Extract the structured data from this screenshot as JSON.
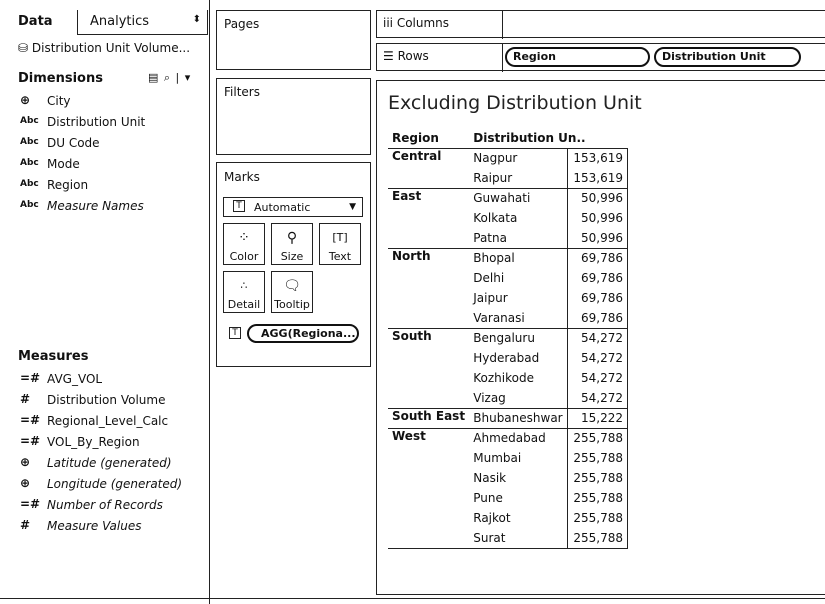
{
  "data_pane": {
    "tabs": {
      "data": "Data",
      "analytics": "Analytics"
    },
    "datasource": "Distribution Unit Volume...",
    "dimensions_title": "Dimensions",
    "dimensions_tools": "▤ ⌕ | ▾",
    "dimensions": [
      {
        "type": "Abc",
        "name": "City"
      },
      {
        "type": "Abc",
        "name": "Distribution Unit"
      },
      {
        "type": "Abc",
        "name": "DU Code"
      },
      {
        "type": "Abc",
        "name": "Mode"
      },
      {
        "type": "Abc",
        "name": "Region"
      },
      {
        "type": "Abc",
        "name": "Measure Names"
      }
    ],
    "measures_title": "Measures",
    "measures": [
      {
        "type": "=#",
        "name": "AVG_VOL"
      },
      {
        "type": "#",
        "name": "Distribution Volume"
      },
      {
        "type": "=#",
        "name": "Regional_Level_Calc"
      },
      {
        "type": "=#",
        "name": "VOL_By_Region"
      },
      {
        "type": "geo",
        "name": "Latitude (generated)"
      },
      {
        "type": "geo",
        "name": "Longitude (generated)"
      },
      {
        "type": "=#",
        "name": "Number of Records"
      },
      {
        "type": "#",
        "name": "Measure Values"
      }
    ]
  },
  "shelves": {
    "pages": "Pages",
    "filters": "Filters",
    "marks": "Marks",
    "mark_type": "Automatic",
    "mark_buttons": {
      "color": "Color",
      "size": "Size",
      "text": "Text",
      "detail": "Detail",
      "tooltip": "Tooltip"
    },
    "marks_pill": "AGG(Regiona...",
    "columns_label": "iii  Columns",
    "rows_label": "☰  Rows",
    "rows_pills": [
      "Region",
      "Distribution Unit"
    ]
  },
  "view": {
    "title": "Excluding Distribution Unit",
    "headers": [
      "Region",
      "Distribution Un.."
    ],
    "rows": [
      {
        "region": "Central",
        "unit": "Nagpur",
        "value": "153,619"
      },
      {
        "region": "",
        "unit": "Raipur",
        "value": "153,619"
      },
      {
        "region": "East",
        "unit": "Guwahati",
        "value": "50,996"
      },
      {
        "region": "",
        "unit": "Kolkata",
        "value": "50,996"
      },
      {
        "region": "",
        "unit": "Patna",
        "value": "50,996"
      },
      {
        "region": "North",
        "unit": "Bhopal",
        "value": "69,786"
      },
      {
        "region": "",
        "unit": "Delhi",
        "value": "69,786"
      },
      {
        "region": "",
        "unit": "Jaipur",
        "value": "69,786"
      },
      {
        "region": "",
        "unit": "Varanasi",
        "value": "69,786"
      },
      {
        "region": "South",
        "unit": "Bengaluru",
        "value": "54,272"
      },
      {
        "region": "",
        "unit": "Hyderabad",
        "value": "54,272"
      },
      {
        "region": "",
        "unit": "Kozhikode",
        "value": "54,272"
      },
      {
        "region": "",
        "unit": "Vizag",
        "value": "54,272"
      },
      {
        "region": "South East",
        "unit": "Bhubaneshwar",
        "value": "15,222"
      },
      {
        "region": "West",
        "unit": "Ahmedabad",
        "value": "255,788"
      },
      {
        "region": "",
        "unit": "Mumbai",
        "value": "255,788"
      },
      {
        "region": "",
        "unit": "Nasik",
        "value": "255,788"
      },
      {
        "region": "",
        "unit": "Pune",
        "value": "255,788"
      },
      {
        "region": "",
        "unit": "Rajkot",
        "value": "255,788"
      },
      {
        "region": "",
        "unit": "Surat",
        "value": "255,788"
      }
    ]
  }
}
